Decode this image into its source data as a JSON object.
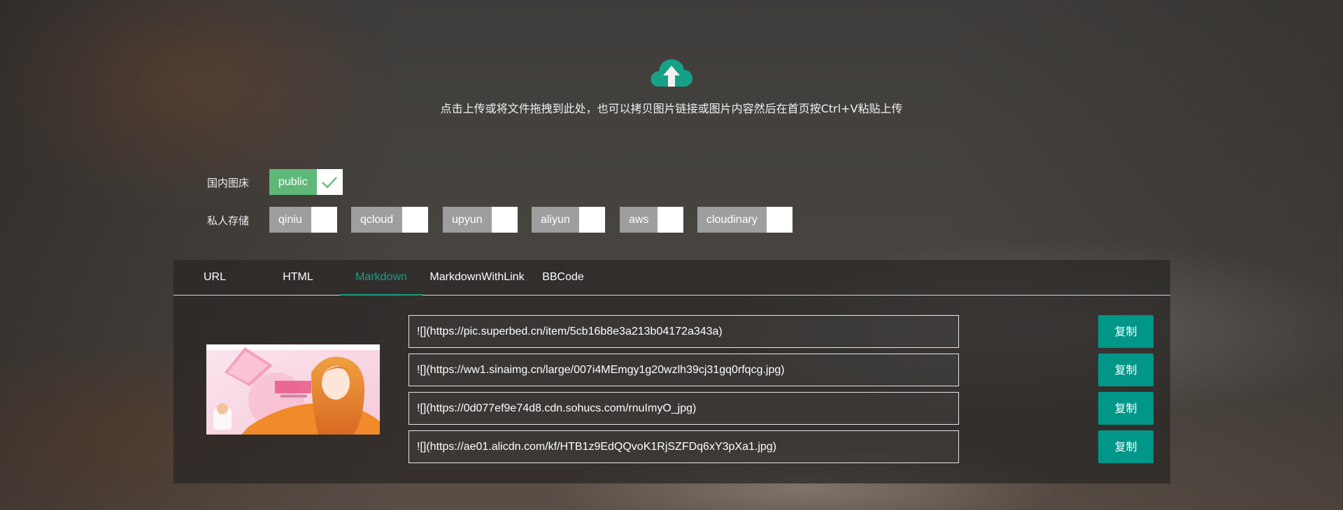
{
  "upload": {
    "icon": "cloud-upload-icon",
    "hint": "点击上传或将文件拖拽到此处，也可以拷贝图片链接或图片内容然后在首页按Ctrl+V粘贴上传"
  },
  "public_bed": {
    "label": "国内图床",
    "options": [
      {
        "name": "public",
        "checked": true
      }
    ]
  },
  "private_storage": {
    "label": "私人存储",
    "options": [
      {
        "name": "qiniu",
        "checked": false
      },
      {
        "name": "qcloud",
        "checked": false
      },
      {
        "name": "upyun",
        "checked": false
      },
      {
        "name": "aliyun",
        "checked": false
      },
      {
        "name": "aws",
        "checked": false
      },
      {
        "name": "cloudinary",
        "checked": false
      }
    ]
  },
  "tabs": [
    {
      "label": "URL",
      "active": false
    },
    {
      "label": "HTML",
      "active": false
    },
    {
      "label": "Markdown",
      "active": true
    },
    {
      "label": "MarkdownWithLink",
      "active": false
    },
    {
      "label": "BBCode",
      "active": false
    }
  ],
  "links": [
    {
      "value": "![](https://pic.superbed.cn/item/5cb16b8e3a213b04172a343a)",
      "button": "复制"
    },
    {
      "value": "![](https://ww1.sinaimg.cn/large/007i4MEmgy1g20wzlh39cj31gq0rfqcg.jpg)",
      "button": "复制"
    },
    {
      "value": "![](https://0d077ef9e74d8.cdn.sohucs.com/rnuImyO_jpg)",
      "button": "复制"
    },
    {
      "value": "![](https://ae01.alicdn.com/kf/HTB1z9EdQQvoK1RjSZFDq6xY3pXa1.jpg)",
      "button": "复制"
    }
  ],
  "colors": {
    "accent": "#009688",
    "tab_active": "#16a085",
    "toggle_on": "#5fb878",
    "toggle_off": "#9e9e9e"
  }
}
